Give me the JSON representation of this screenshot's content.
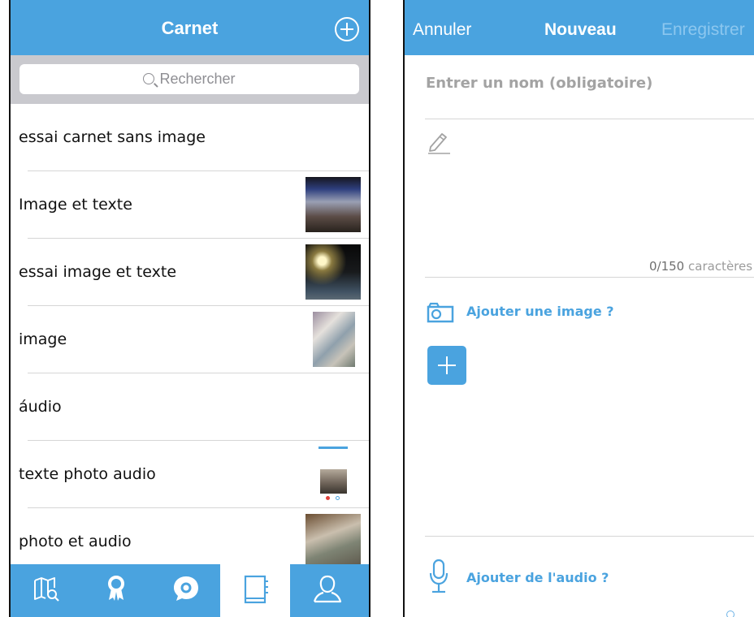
{
  "left": {
    "navbar": {
      "title": "Carnet",
      "add_icon": "plus-circle-icon"
    },
    "search": {
      "placeholder": "Rechercher",
      "icon": "search-icon"
    },
    "notebooks": [
      {
        "label": "essai carnet sans image",
        "thumbnail": false
      },
      {
        "label": "Image et texte",
        "thumbnail": true
      },
      {
        "label": "essai image et texte",
        "thumbnail": true
      },
      {
        "label": "image",
        "thumbnail": true
      },
      {
        "label": "áudio",
        "thumbnail": false
      },
      {
        "label": "texte photo audio",
        "thumbnail": true
      },
      {
        "label": "photo et audio",
        "thumbnail": true
      }
    ],
    "tabbar": {
      "items": [
        "map-search-icon",
        "award-ribbon-icon",
        "chat-bubble-icon",
        "notebook-icon",
        "profile-icon"
      ],
      "selected": "notebook-icon"
    }
  },
  "right": {
    "navbar": {
      "cancel": "Annuler",
      "title": "Nouveau",
      "save": "Enregistrer"
    },
    "name_placeholder": "Entrer un nom (obligatoire)",
    "char_count": "0/150",
    "char_label": "caractères",
    "add_image": "Ajouter une image ?",
    "add_audio": "Ajouter de l'audio ?"
  },
  "colors": {
    "primary": "#4aa3df",
    "search_bar_bg": "#c9c9ce",
    "save_disabled": "#8cc7ef",
    "placeholder": "#a3a3a3",
    "separator": "#d6d6d6"
  }
}
